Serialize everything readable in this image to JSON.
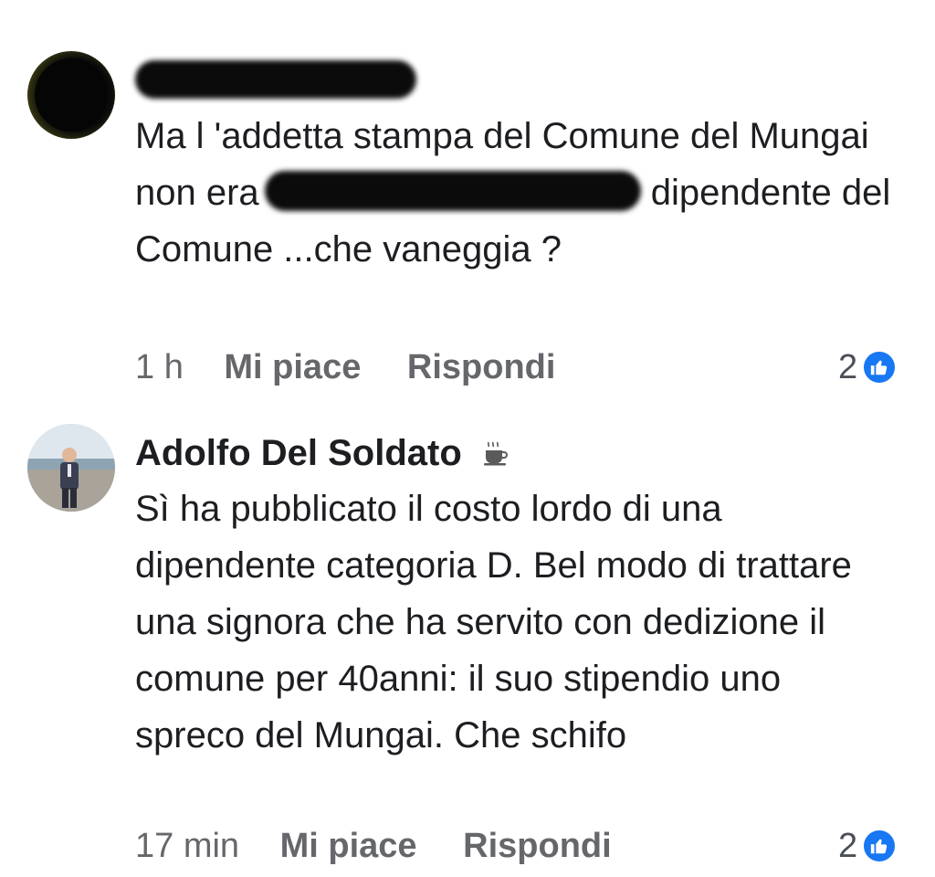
{
  "comments": [
    {
      "author": "",
      "author_redacted": true,
      "text_before_redaction": "Ma l 'addetta stampa del Comune del Mungai non era",
      "text_after_redaction": "dipendente del Comune ...che vaneggia ?",
      "time": "1 h",
      "like_label": "Mi piace",
      "reply_label": "Rispondi",
      "reaction_count": "2",
      "reaction_icon": "thumbs-up-icon",
      "avatar_icon": "redacted-avatar"
    },
    {
      "author": "Adolfo Del Soldato",
      "author_badge_icon": "coffee-cup-icon",
      "text": "Sì ha pubblicato il costo lordo di una dipendente categoria D. Bel modo di trattare una signora che ha servito con dedizione il comune per 40anni: il suo stipendio uno spreco del Mungai.  Che schifo",
      "time": "17 min",
      "like_label": "Mi piace",
      "reply_label": "Rispondi",
      "reaction_count": "2",
      "reaction_icon": "thumbs-up-icon",
      "avatar_icon": "profile-photo"
    }
  ],
  "colors": {
    "text": "#1c1e21",
    "meta": "#65676b",
    "like_badge": "#1877f2"
  }
}
